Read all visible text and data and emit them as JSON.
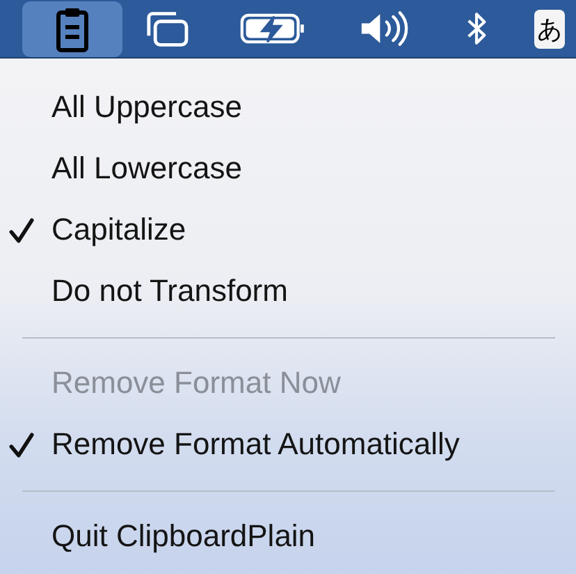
{
  "menu_bar": {
    "icons": [
      {
        "kind": "clipboard",
        "selected": true
      },
      {
        "kind": "windows",
        "selected": false
      },
      {
        "kind": "battery",
        "selected": false
      },
      {
        "kind": "volume",
        "selected": false
      },
      {
        "kind": "bluetooth",
        "selected": false
      }
    ],
    "input_source": "あ"
  },
  "menu": {
    "items": [
      {
        "kind": "item",
        "label": "All Uppercase",
        "checked": false,
        "disabled": false
      },
      {
        "kind": "item",
        "label": "All Lowercase",
        "checked": false,
        "disabled": false
      },
      {
        "kind": "item",
        "label": "Capitalize",
        "checked": true,
        "disabled": false
      },
      {
        "kind": "item",
        "label": "Do not Transform",
        "checked": false,
        "disabled": false
      },
      {
        "kind": "separator"
      },
      {
        "kind": "item",
        "label": "Remove Format Now",
        "checked": false,
        "disabled": true
      },
      {
        "kind": "item",
        "label": "Remove Format Automatically",
        "checked": true,
        "disabled": false
      },
      {
        "kind": "separator"
      },
      {
        "kind": "item",
        "label": "Quit ClipboardPlain",
        "checked": false,
        "disabled": false
      }
    ]
  }
}
